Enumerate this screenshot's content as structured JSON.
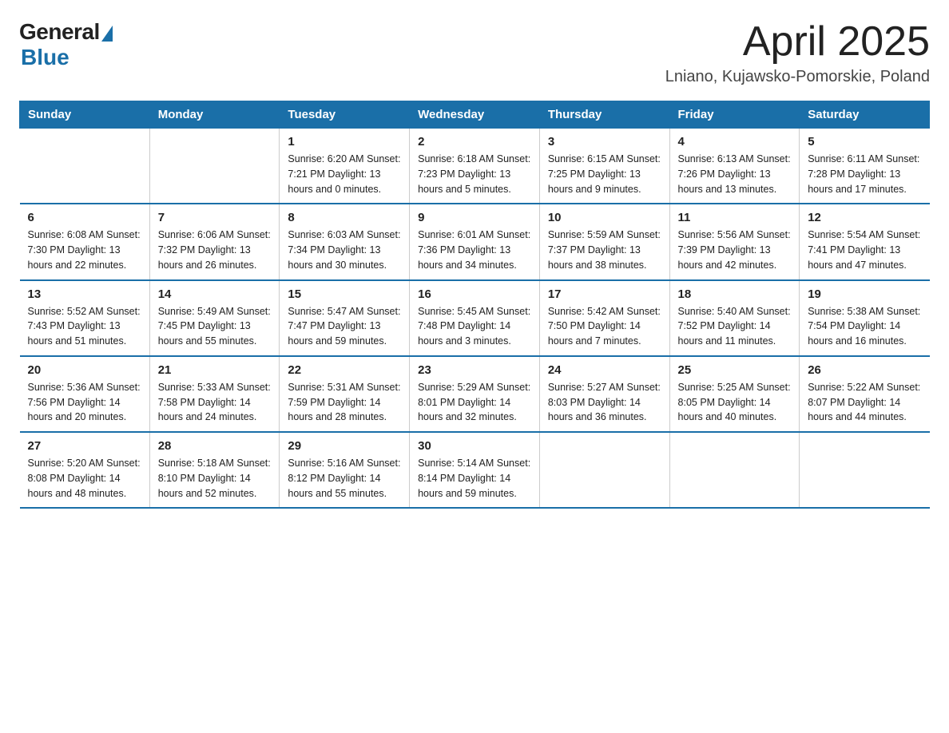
{
  "header": {
    "logo_general": "General",
    "logo_blue": "Blue",
    "title": "April 2025",
    "location": "Lniano, Kujawsko-Pomorskie, Poland"
  },
  "weekdays": [
    "Sunday",
    "Monday",
    "Tuesday",
    "Wednesday",
    "Thursday",
    "Friday",
    "Saturday"
  ],
  "weeks": [
    [
      {
        "day": "",
        "info": ""
      },
      {
        "day": "",
        "info": ""
      },
      {
        "day": "1",
        "info": "Sunrise: 6:20 AM\nSunset: 7:21 PM\nDaylight: 13 hours\nand 0 minutes."
      },
      {
        "day": "2",
        "info": "Sunrise: 6:18 AM\nSunset: 7:23 PM\nDaylight: 13 hours\nand 5 minutes."
      },
      {
        "day": "3",
        "info": "Sunrise: 6:15 AM\nSunset: 7:25 PM\nDaylight: 13 hours\nand 9 minutes."
      },
      {
        "day": "4",
        "info": "Sunrise: 6:13 AM\nSunset: 7:26 PM\nDaylight: 13 hours\nand 13 minutes."
      },
      {
        "day": "5",
        "info": "Sunrise: 6:11 AM\nSunset: 7:28 PM\nDaylight: 13 hours\nand 17 minutes."
      }
    ],
    [
      {
        "day": "6",
        "info": "Sunrise: 6:08 AM\nSunset: 7:30 PM\nDaylight: 13 hours\nand 22 minutes."
      },
      {
        "day": "7",
        "info": "Sunrise: 6:06 AM\nSunset: 7:32 PM\nDaylight: 13 hours\nand 26 minutes."
      },
      {
        "day": "8",
        "info": "Sunrise: 6:03 AM\nSunset: 7:34 PM\nDaylight: 13 hours\nand 30 minutes."
      },
      {
        "day": "9",
        "info": "Sunrise: 6:01 AM\nSunset: 7:36 PM\nDaylight: 13 hours\nand 34 minutes."
      },
      {
        "day": "10",
        "info": "Sunrise: 5:59 AM\nSunset: 7:37 PM\nDaylight: 13 hours\nand 38 minutes."
      },
      {
        "day": "11",
        "info": "Sunrise: 5:56 AM\nSunset: 7:39 PM\nDaylight: 13 hours\nand 42 minutes."
      },
      {
        "day": "12",
        "info": "Sunrise: 5:54 AM\nSunset: 7:41 PM\nDaylight: 13 hours\nand 47 minutes."
      }
    ],
    [
      {
        "day": "13",
        "info": "Sunrise: 5:52 AM\nSunset: 7:43 PM\nDaylight: 13 hours\nand 51 minutes."
      },
      {
        "day": "14",
        "info": "Sunrise: 5:49 AM\nSunset: 7:45 PM\nDaylight: 13 hours\nand 55 minutes."
      },
      {
        "day": "15",
        "info": "Sunrise: 5:47 AM\nSunset: 7:47 PM\nDaylight: 13 hours\nand 59 minutes."
      },
      {
        "day": "16",
        "info": "Sunrise: 5:45 AM\nSunset: 7:48 PM\nDaylight: 14 hours\nand 3 minutes."
      },
      {
        "day": "17",
        "info": "Sunrise: 5:42 AM\nSunset: 7:50 PM\nDaylight: 14 hours\nand 7 minutes."
      },
      {
        "day": "18",
        "info": "Sunrise: 5:40 AM\nSunset: 7:52 PM\nDaylight: 14 hours\nand 11 minutes."
      },
      {
        "day": "19",
        "info": "Sunrise: 5:38 AM\nSunset: 7:54 PM\nDaylight: 14 hours\nand 16 minutes."
      }
    ],
    [
      {
        "day": "20",
        "info": "Sunrise: 5:36 AM\nSunset: 7:56 PM\nDaylight: 14 hours\nand 20 minutes."
      },
      {
        "day": "21",
        "info": "Sunrise: 5:33 AM\nSunset: 7:58 PM\nDaylight: 14 hours\nand 24 minutes."
      },
      {
        "day": "22",
        "info": "Sunrise: 5:31 AM\nSunset: 7:59 PM\nDaylight: 14 hours\nand 28 minutes."
      },
      {
        "day": "23",
        "info": "Sunrise: 5:29 AM\nSunset: 8:01 PM\nDaylight: 14 hours\nand 32 minutes."
      },
      {
        "day": "24",
        "info": "Sunrise: 5:27 AM\nSunset: 8:03 PM\nDaylight: 14 hours\nand 36 minutes."
      },
      {
        "day": "25",
        "info": "Sunrise: 5:25 AM\nSunset: 8:05 PM\nDaylight: 14 hours\nand 40 minutes."
      },
      {
        "day": "26",
        "info": "Sunrise: 5:22 AM\nSunset: 8:07 PM\nDaylight: 14 hours\nand 44 minutes."
      }
    ],
    [
      {
        "day": "27",
        "info": "Sunrise: 5:20 AM\nSunset: 8:08 PM\nDaylight: 14 hours\nand 48 minutes."
      },
      {
        "day": "28",
        "info": "Sunrise: 5:18 AM\nSunset: 8:10 PM\nDaylight: 14 hours\nand 52 minutes."
      },
      {
        "day": "29",
        "info": "Sunrise: 5:16 AM\nSunset: 8:12 PM\nDaylight: 14 hours\nand 55 minutes."
      },
      {
        "day": "30",
        "info": "Sunrise: 5:14 AM\nSunset: 8:14 PM\nDaylight: 14 hours\nand 59 minutes."
      },
      {
        "day": "",
        "info": ""
      },
      {
        "day": "",
        "info": ""
      },
      {
        "day": "",
        "info": ""
      }
    ]
  ]
}
